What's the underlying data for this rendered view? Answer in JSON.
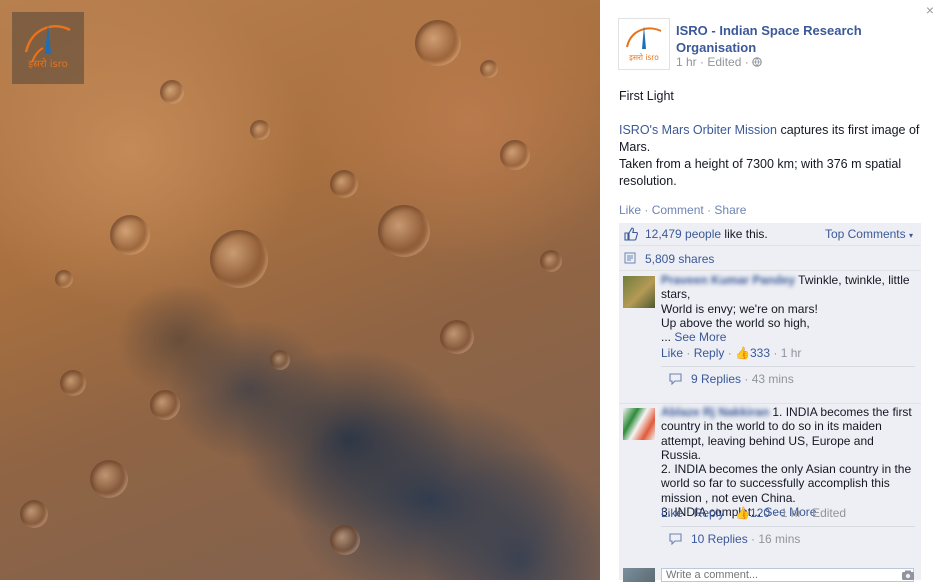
{
  "logo": {
    "text": "इसरो isro",
    "accent": "#e8731c"
  },
  "post": {
    "page_name": "ISRO - Indian Space Research Organisation",
    "time": "1 hr",
    "edited": "Edited",
    "title_line": "First Light",
    "mission_link": "ISRO's Mars Orbiter Mission",
    "body_after_link": " captures its first image of Mars.",
    "body_line2": "Taken from a height of 7300 km; with 376 m spatial resolution."
  },
  "actions": {
    "like": "Like",
    "comment": "Comment",
    "share": "Share",
    "sep": "·"
  },
  "ufi": {
    "likes_link": "12,479 people",
    "likes_suffix": " like this.",
    "top_comments": "Top Comments",
    "shares": "5,809 shares"
  },
  "comments": [
    {
      "author": "Praveen Kumar Pandey",
      "text_line1": " Twinkle, twinkle, little stars,",
      "text_line2": "World is envy; we're on mars!",
      "text_line3": "Up above the world so high,",
      "text_line4": "...",
      "see_more": "See More",
      "like": "Like",
      "reply": "Reply",
      "likes": "333",
      "time": "1 hr",
      "replies_label": "9 Replies",
      "replies_time": "43 mins"
    },
    {
      "author": "Ablaze Rj Nakkiran",
      "text_line1": " 1. INDIA becomes the first country in the world to do so in its maiden attempt, leaving behind US, Europe and Russia.",
      "text_line2": "2. INDIA becomes the only Asian country in the world so far to successfully accomplish this mission , not even China.",
      "text_line3": "3. INDIA complet...",
      "see_more": "See More",
      "like": "Like",
      "reply": "Reply",
      "likes": "120",
      "time": "1 hr",
      "edited": "Edited",
      "replies_label": "10 Replies",
      "replies_time": "16 mins"
    }
  ],
  "write_comment": {
    "placeholder": "Write a comment..."
  },
  "close_label": "×"
}
